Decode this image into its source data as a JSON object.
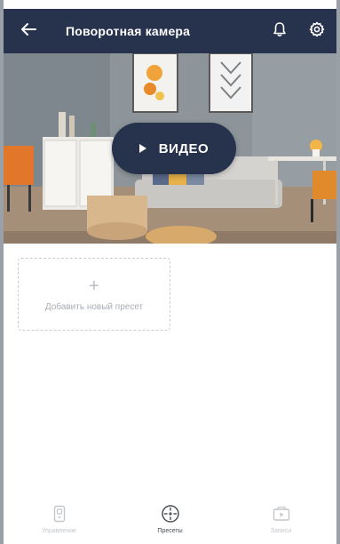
{
  "header": {
    "title": "Поворотная камера",
    "back_icon": "arrow-left-icon",
    "bell_icon": "bell-icon",
    "settings_icon": "gear-icon",
    "background": "#27324d"
  },
  "preview": {
    "video_button_label": "ВИДЕО",
    "play_icon": "play-icon"
  },
  "presets": {
    "add_label": "Добавить новый пресет",
    "plus_icon": "plus-icon"
  },
  "bottom_nav": {
    "items": [
      {
        "label": "Управление",
        "icon": "remote-icon",
        "active": false
      },
      {
        "label": "Пресеты",
        "icon": "target-icon",
        "active": true
      },
      {
        "label": "Записи",
        "icon": "video-folder-icon",
        "active": false
      }
    ]
  }
}
